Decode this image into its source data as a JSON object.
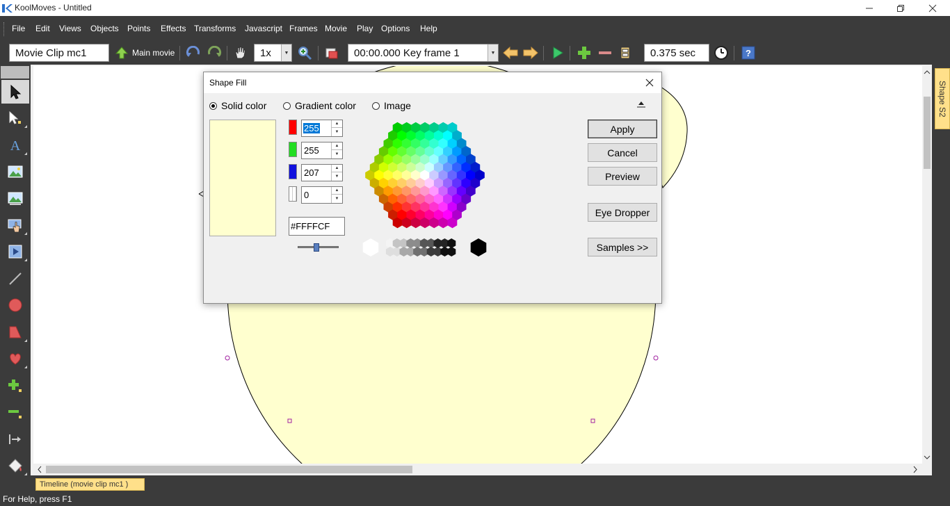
{
  "window": {
    "title": "KoolMoves - Untitled"
  },
  "menu": [
    "File",
    "Edit",
    "Views",
    "Objects",
    "Points",
    "Effects",
    "Transforms",
    "Javascript",
    "Frames",
    "Movie",
    "Play",
    "Options",
    "Help"
  ],
  "toolbar": {
    "clip_name": "Movie Clip mc1",
    "main_movie_label": "Main movie",
    "zoom": "1x",
    "frame": "00:00.000  Key frame 1",
    "duration": "0.375 sec"
  },
  "dialog": {
    "title": "Shape Fill",
    "options": {
      "solid": "Solid color",
      "gradient": "Gradient color",
      "image": "Image",
      "selected": "solid"
    },
    "channels": {
      "red": "255",
      "green": "255",
      "blue": "207",
      "alpha": "0"
    },
    "hex": "#FFFFCF",
    "buttons": {
      "apply": "Apply",
      "cancel": "Cancel",
      "preview": "Preview",
      "eye_dropper": "Eye Dropper",
      "samples": "Samples >>"
    }
  },
  "colors": {
    "selected_fill": "#FFFFCF",
    "chrome_dark": "#3b3b3b",
    "tab_yellow": "#ffe08a",
    "selection_blue": "#0078d7"
  },
  "right_tab": "Shape S2",
  "timeline_tab": "Timeline (movie clip mc1 )",
  "status": "For Help, press F1"
}
